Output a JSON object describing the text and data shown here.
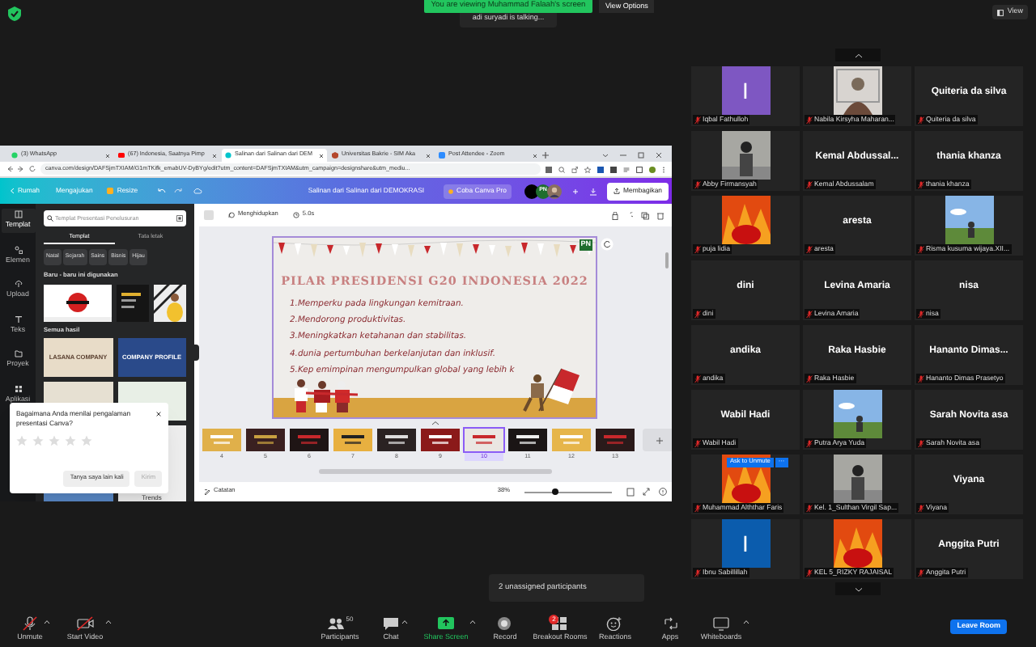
{
  "top_bar": {
    "banner": "You are viewing Muhammad Falaah's screen",
    "view_options": "View Options",
    "talking": "adi suryadi is talking...",
    "view": "View"
  },
  "browser": {
    "tabs": [
      {
        "label": "(3) WhatsApp",
        "selected": false
      },
      {
        "label": "(67) Indonesia, Saatnya Pimp",
        "selected": false
      },
      {
        "label": "Salinan dari Salinan dari DEM",
        "selected": true
      },
      {
        "label": "Universitas Bakrie - SIM Aka",
        "selected": false
      },
      {
        "label": "Post Attendee - Zoom",
        "selected": false
      }
    ],
    "url": "canva.com/design/DAFSjmTXIAM/G1mTKifk_emabUV-DyBYg/edit?utm_content=DAFSjmTXIAM&utm_campaign=designshare&utm_mediu..."
  },
  "canva": {
    "header": {
      "home": "Rumah",
      "submit": "Mengajukan",
      "resize": "Resize",
      "title": "Salinan dari Salinan dari DEMOKRASI",
      "pro": "Coba Canva Pro",
      "avatar_initials": "PN",
      "share": "Membagikan"
    },
    "rail": [
      {
        "label": "Templat",
        "selected": true
      },
      {
        "label": "Elemen",
        "selected": false
      },
      {
        "label": "Upload",
        "selected": false
      },
      {
        "label": "Teks",
        "selected": false
      },
      {
        "label": "Proyek",
        "selected": false
      },
      {
        "label": "Aplikasi",
        "selected": false
      }
    ],
    "panel": {
      "search_placeholder": "Templat Presentasi Penelusuran",
      "tabs": [
        {
          "label": "Templat",
          "selected": true
        },
        {
          "label": "Tata letak",
          "selected": false
        }
      ],
      "chips": [
        "Natal",
        "Sejarah",
        "Sains",
        "Bisnis",
        "Hijau"
      ],
      "recent_heading": "Baru - baru ini digunakan",
      "all_heading": "Semua hasil",
      "results": [
        {
          "title": "LASANA COMPANY"
        },
        {
          "title": "COMPANY PROFILE"
        },
        {
          "title": "Trends"
        }
      ]
    },
    "toolbar": {
      "animate": "Menghidupkan",
      "duration": "5.0s"
    },
    "slide": {
      "badge": "PN",
      "title": "PILAR PRESIDENSI G20 INDONESIA 2022",
      "points": [
        "1.Memperku pada lingkungan kemitraan.",
        "2.Mendorong produktivitas.",
        "3.Meningkatkan ketahanan dan stabilitas.",
        "4.dunia pertumbuhan berkelanjutan dan inklusif.",
        "5.Kep emimpinan mengumpulkan global yang lebih k"
      ]
    },
    "pages": [
      {
        "number": "4",
        "selected": false
      },
      {
        "number": "5",
        "selected": false
      },
      {
        "number": "6",
        "selected": false
      },
      {
        "number": "7",
        "selected": false
      },
      {
        "number": "8",
        "selected": false
      },
      {
        "number": "9",
        "selected": false
      },
      {
        "number": "10",
        "selected": true
      },
      {
        "number": "11",
        "selected": false
      },
      {
        "number": "12",
        "selected": false
      },
      {
        "number": "13",
        "selected": false
      }
    ],
    "bottom": {
      "notes": "Catatan",
      "zoom": "38%",
      "level": 0.35
    },
    "rating": {
      "question": "Bagaimana Anda menilai pengalaman presentasi Canva?",
      "stars": 0,
      "later": "Tanya saya lain kali",
      "send": "Kirim"
    }
  },
  "participants": [
    {
      "kind": "avatar",
      "letter": "I",
      "color": "#7e57c2",
      "label": "Iqbal Fathulloh"
    },
    {
      "kind": "picture",
      "label": "Nabila Kirsyha Maharan..."
    },
    {
      "kind": "name",
      "display_name": "Quiteria da silva",
      "label": "Quiteria da silva"
    },
    {
      "kind": "picture",
      "label": "Abby Firmansyah"
    },
    {
      "kind": "name",
      "display_name": "Kemal  Abdussal...",
      "label": "Kemal Abdussalam"
    },
    {
      "kind": "name",
      "display_name": "thania khanza",
      "label": "thania khanza"
    },
    {
      "kind": "picture",
      "label": "puja lidia"
    },
    {
      "kind": "name",
      "display_name": "aresta",
      "label": "aresta"
    },
    {
      "kind": "picture",
      "label": "Risma kusuma wijaya.XII..."
    },
    {
      "kind": "name",
      "display_name": "dini",
      "label": "dini"
    },
    {
      "kind": "name",
      "display_name": "Levina Amaria",
      "label": "Levina Amaria"
    },
    {
      "kind": "name",
      "display_name": "nisa",
      "label": "nisa"
    },
    {
      "kind": "name",
      "display_name": "andika",
      "label": "andika"
    },
    {
      "kind": "name",
      "display_name": "Raka Hasbie",
      "label": "Raka Hasbie"
    },
    {
      "kind": "name",
      "display_name": "Hananto  Dimas...",
      "label": "Hananto Dimas Prasetyo"
    },
    {
      "kind": "name",
      "display_name": "Wabil Hadi",
      "label": "Wabil Hadi"
    },
    {
      "kind": "picture",
      "label": "Putra Arya Yuda"
    },
    {
      "kind": "name",
      "display_name": "Sarah Novita asa",
      "label": "Sarah Novita asa"
    },
    {
      "kind": "picture",
      "label": "Muhammad Alththar Faris",
      "hover_button": "Ask to Unmute",
      "more": "···"
    },
    {
      "kind": "picture",
      "label": "Kel. 1_Sulthan Virgil Sap..."
    },
    {
      "kind": "name",
      "display_name": "Viyana",
      "label": "Viyana"
    },
    {
      "kind": "avatar",
      "letter": "I",
      "color": "#0b5cad",
      "label": "Ibnu Sabillillah"
    },
    {
      "kind": "picture",
      "label": "KEL 5_RIZKY RAJAISAL"
    },
    {
      "kind": "name",
      "display_name": "Anggita Putri",
      "label": "Anggita Putri"
    }
  ],
  "popup": "2 unassigned participants",
  "toolbar": {
    "items": [
      {
        "kind": "mic",
        "label": "Unmute",
        "caret": true
      },
      {
        "kind": "video",
        "label": "Start Video",
        "caret": true
      },
      {
        "kind": "participants",
        "label": "Participants",
        "count": "50",
        "caret": false
      },
      {
        "kind": "chat",
        "label": "Chat",
        "caret": true
      },
      {
        "kind": "share",
        "label": "Share Screen",
        "caret": true
      },
      {
        "kind": "record",
        "label": "Record",
        "caret": false
      },
      {
        "kind": "breakout",
        "label": "Breakout Rooms",
        "badge": "2",
        "caret": false
      },
      {
        "kind": "reactions",
        "label": "Reactions",
        "caret": false
      },
      {
        "kind": "apps",
        "label": "Apps",
        "caret": false
      },
      {
        "kind": "whiteboard",
        "label": "Whiteboards",
        "caret": true
      }
    ],
    "leave": "Leave Room"
  }
}
